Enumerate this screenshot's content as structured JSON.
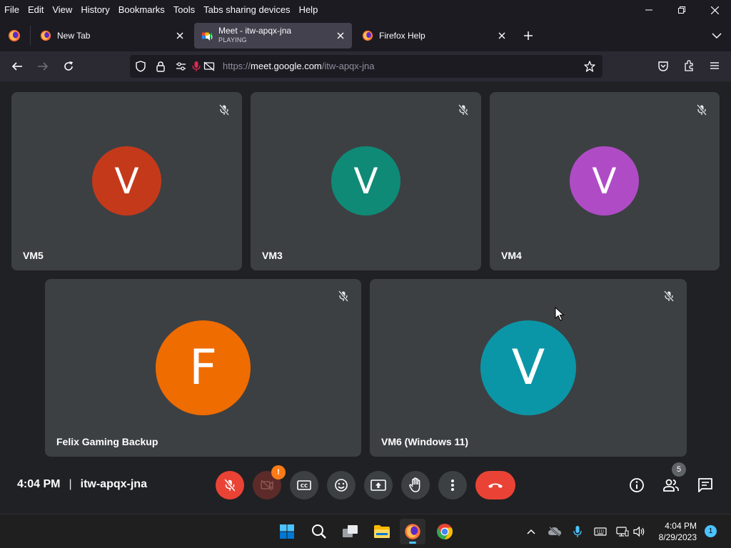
{
  "menu": {
    "items": [
      "File",
      "Edit",
      "View",
      "History",
      "Bookmarks",
      "Tools",
      "Tabs sharing devices",
      "Help"
    ]
  },
  "tabs": [
    {
      "title": "New Tab",
      "subtitle": "",
      "active": false
    },
    {
      "title": "Meet - itw-apqx-jna",
      "subtitle": "PLAYING",
      "active": true
    },
    {
      "title": "Firefox Help",
      "subtitle": "",
      "active": false
    }
  ],
  "url": {
    "prefix": "https://",
    "host": "meet.google.com",
    "path": "/itw-apqx-jna"
  },
  "participants": [
    {
      "name": "VM5",
      "initial": "V",
      "color": "#c5391b"
    },
    {
      "name": "VM3",
      "initial": "V",
      "color": "#0f8a76"
    },
    {
      "name": "VM4",
      "initial": "V",
      "color": "#b04bc6"
    },
    {
      "name": "Felix Gaming Backup",
      "initial": "F",
      "color": "#ef6c00"
    },
    {
      "name": "VM6 (Windows 11)",
      "initial": "V",
      "color": "#0b96a7"
    }
  ],
  "meeting": {
    "time": "4:04 PM",
    "separator": "|",
    "code": "itw-apqx-jna",
    "camera_alert": "!",
    "people_count": "5"
  },
  "colors": {
    "tile_bg": "#3c4043",
    "page_bg": "#202124",
    "danger": "#ea4335",
    "taskbar_accent": "#4cc2ff"
  },
  "taskbar": {
    "time": "4:04 PM",
    "date": "8/29/2023",
    "notifications": "1"
  }
}
